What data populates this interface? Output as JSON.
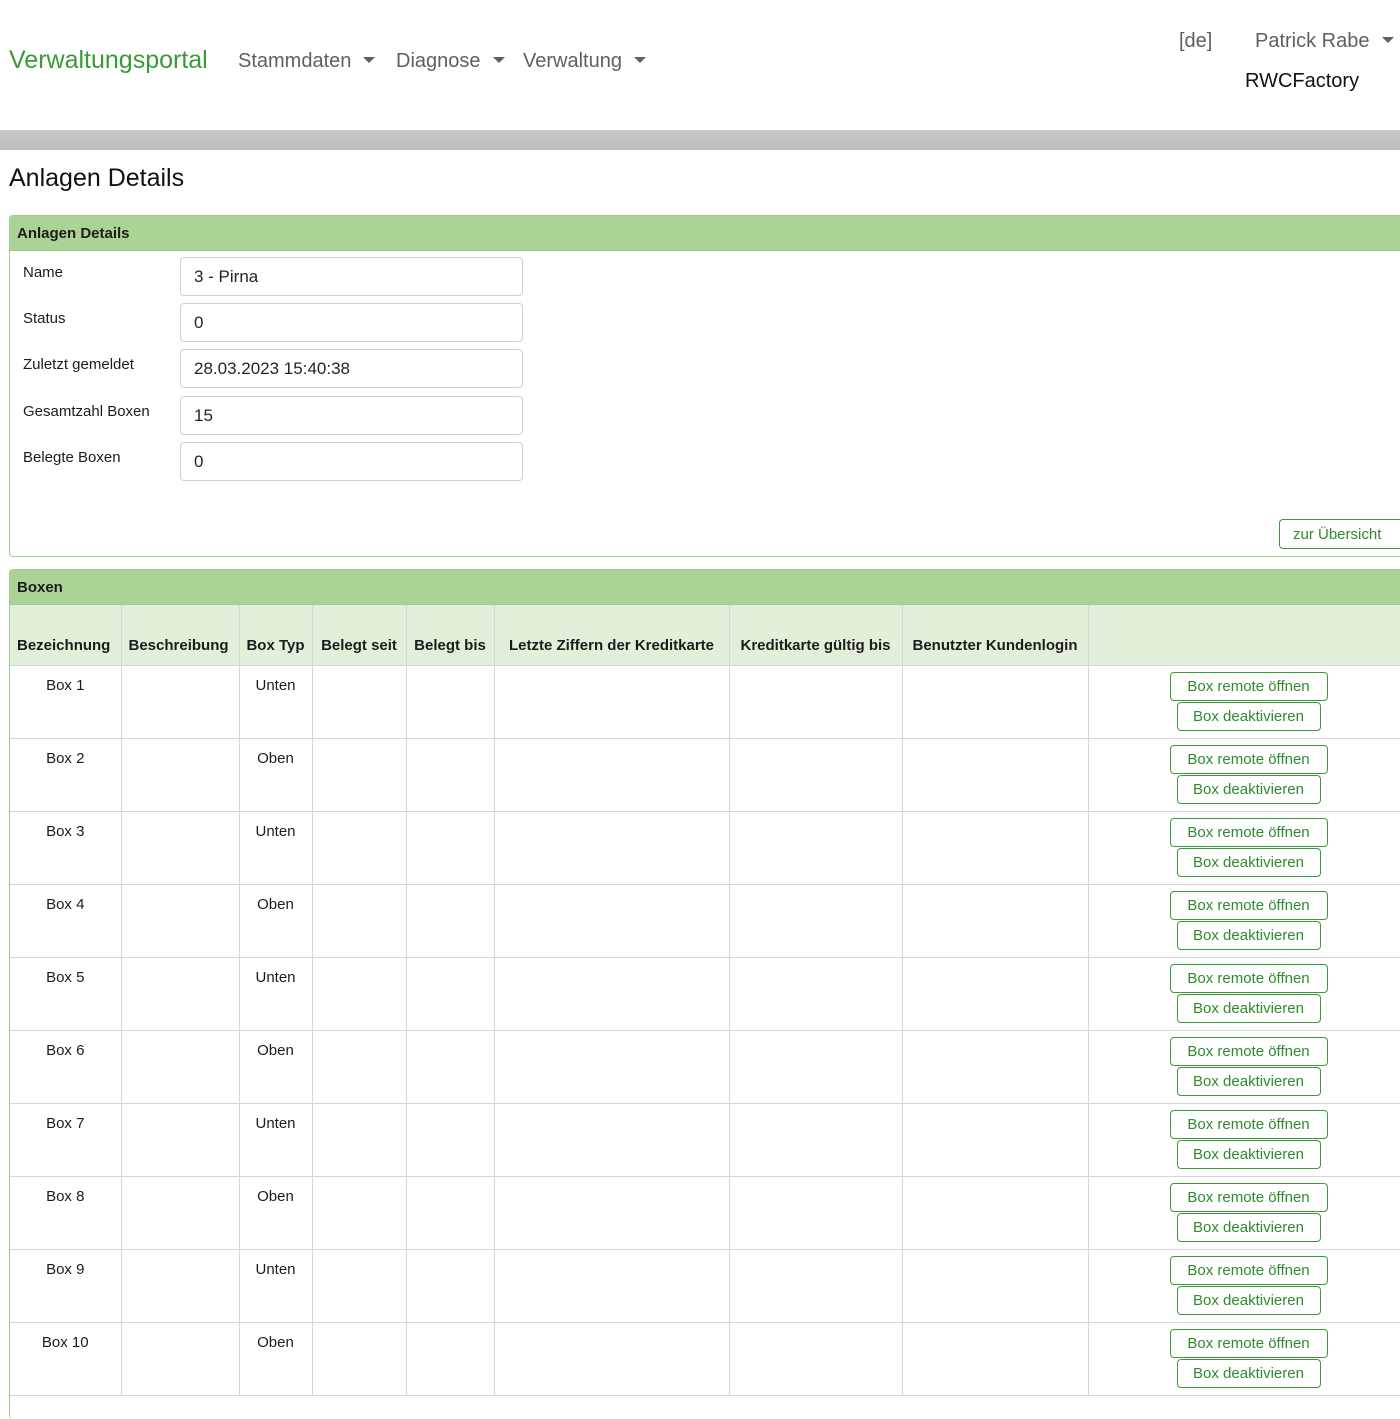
{
  "navbar": {
    "brand": "Verwaltungsportal",
    "menus": [
      "Stammdaten",
      "Diagnose",
      "Verwaltung"
    ],
    "language": "[de]",
    "user": "Patrick Rabe",
    "company": "RWCFactory"
  },
  "page": {
    "title": "Anlagen Details"
  },
  "details": {
    "header": "Anlagen Details",
    "fields": [
      {
        "label": "Name",
        "value": "3 - Pirna"
      },
      {
        "label": "Status",
        "value": "0"
      },
      {
        "label": "Zuletzt gemeldet",
        "value": "28.03.2023 15:40:38"
      },
      {
        "label": "Gesamtzahl Boxen",
        "value": "15"
      },
      {
        "label": "Belegte Boxen",
        "value": "0"
      }
    ],
    "overview_button": "zur Übersicht"
  },
  "boxes": {
    "header": "Boxen",
    "columns": [
      "Bezeichnung",
      "Beschreibung",
      "Box Typ",
      "Belegt seit",
      "Belegt bis",
      "Letzte Ziffern der Kreditkarte",
      "Kreditkarte gültig bis",
      "Benutzter Kundenlogin",
      ""
    ],
    "open_label": "Box remote öffnen",
    "deactivate_label": "Box deaktivieren",
    "rows": [
      {
        "name": "Box 1",
        "description": "",
        "type": "Unten",
        "since": "",
        "until": "",
        "card_digits": "",
        "card_valid": "",
        "login": ""
      },
      {
        "name": "Box 2",
        "description": "",
        "type": "Oben",
        "since": "",
        "until": "",
        "card_digits": "",
        "card_valid": "",
        "login": ""
      },
      {
        "name": "Box 3",
        "description": "",
        "type": "Unten",
        "since": "",
        "until": "",
        "card_digits": "",
        "card_valid": "",
        "login": ""
      },
      {
        "name": "Box 4",
        "description": "",
        "type": "Oben",
        "since": "",
        "until": "",
        "card_digits": "",
        "card_valid": "",
        "login": ""
      },
      {
        "name": "Box 5",
        "description": "",
        "type": "Unten",
        "since": "",
        "until": "",
        "card_digits": "",
        "card_valid": "",
        "login": ""
      },
      {
        "name": "Box 6",
        "description": "",
        "type": "Oben",
        "since": "",
        "until": "",
        "card_digits": "",
        "card_valid": "",
        "login": ""
      },
      {
        "name": "Box 7",
        "description": "",
        "type": "Unten",
        "since": "",
        "until": "",
        "card_digits": "",
        "card_valid": "",
        "login": ""
      },
      {
        "name": "Box 8",
        "description": "",
        "type": "Oben",
        "since": "",
        "until": "",
        "card_digits": "",
        "card_valid": "",
        "login": ""
      },
      {
        "name": "Box 9",
        "description": "",
        "type": "Unten",
        "since": "",
        "until": "",
        "card_digits": "",
        "card_valid": "",
        "login": ""
      },
      {
        "name": "Box 10",
        "description": "",
        "type": "Oben",
        "since": "",
        "until": "",
        "card_digits": "",
        "card_valid": "",
        "login": ""
      }
    ]
  },
  "colors": {
    "brand": "#3a9a3a",
    "card_header": "#acd396",
    "table_header": "#e2efda",
    "button_border": "#3a9a3a"
  }
}
